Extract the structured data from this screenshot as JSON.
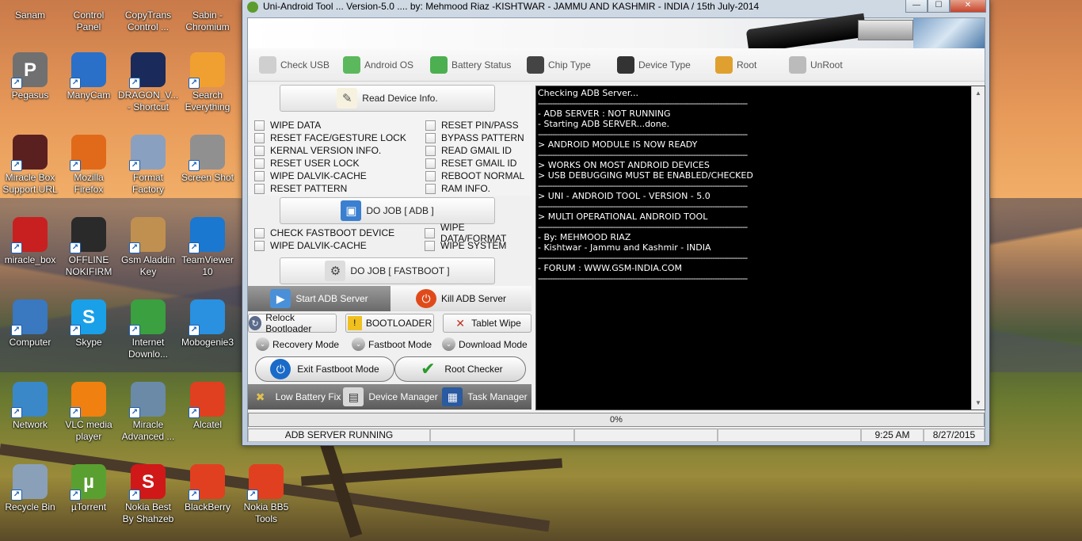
{
  "desktop": {
    "icons": [
      {
        "label": "Sanam",
        "col": 0,
        "row": 0,
        "color": "#b06030",
        "glyph": ""
      },
      {
        "label": "Control\nPanel",
        "col": 1,
        "row": 0,
        "color": "#3a7fc0",
        "glyph": ""
      },
      {
        "label": "CopyTrans\nControl ...",
        "col": 2,
        "row": 0,
        "color": "#4a90d0",
        "glyph": ""
      },
      {
        "label": "Sabin -\nChromium",
        "col": 3,
        "row": 0,
        "color": "#4a80c8",
        "glyph": ""
      },
      {
        "label": "Pegasus",
        "col": 0,
        "row": 1,
        "color": "#707070",
        "glyph": "P"
      },
      {
        "label": "ManyCam",
        "col": 1,
        "row": 1,
        "color": "#2a70c8",
        "glyph": ""
      },
      {
        "label": "DRAGON_V...\n- Shortcut",
        "col": 2,
        "row": 1,
        "color": "#1a2a5a",
        "glyph": ""
      },
      {
        "label": "Search\nEverything",
        "col": 3,
        "row": 1,
        "color": "#f0a030",
        "glyph": ""
      },
      {
        "label": "Miracle Box\nSupport.URL",
        "col": 0,
        "row": 2,
        "color": "#5a2020",
        "glyph": ""
      },
      {
        "label": "Mozilla\nFirefox",
        "col": 1,
        "row": 2,
        "color": "#e06a1a",
        "glyph": ""
      },
      {
        "label": "Format\nFactory",
        "col": 2,
        "row": 2,
        "color": "#8aa0c0",
        "glyph": ""
      },
      {
        "label": "Screen Shot",
        "col": 3,
        "row": 2,
        "color": "#909090",
        "glyph": ""
      },
      {
        "label": "miracle_box",
        "col": 0,
        "row": 3,
        "color": "#c82020",
        "glyph": ""
      },
      {
        "label": "OFFLINE\nNOKIFIRM",
        "col": 1,
        "row": 3,
        "color": "#2a2a2a",
        "glyph": ""
      },
      {
        "label": "Gsm Aladdin\nKey",
        "col": 2,
        "row": 3,
        "color": "#c09050",
        "glyph": ""
      },
      {
        "label": "TeamViewer\n10",
        "col": 3,
        "row": 3,
        "color": "#1a78d0",
        "glyph": ""
      },
      {
        "label": "Computer",
        "col": 0,
        "row": 4,
        "color": "#3a78c0",
        "glyph": ""
      },
      {
        "label": "Skype",
        "col": 1,
        "row": 4,
        "color": "#1aa0e8",
        "glyph": "S"
      },
      {
        "label": "Internet\nDownlo...",
        "col": 2,
        "row": 4,
        "color": "#3aa040",
        "glyph": ""
      },
      {
        "label": "Mobogenie3",
        "col": 3,
        "row": 4,
        "color": "#2a90e0",
        "glyph": ""
      },
      {
        "label": "Network",
        "col": 0,
        "row": 5,
        "color": "#3a88c8",
        "glyph": ""
      },
      {
        "label": "VLC media\nplayer",
        "col": 1,
        "row": 5,
        "color": "#f08010",
        "glyph": ""
      },
      {
        "label": "Miracle\nAdvanced ...",
        "col": 2,
        "row": 5,
        "color": "#6a8aa8",
        "glyph": ""
      },
      {
        "label": "Alcatel",
        "col": 3,
        "row": 5,
        "color": "#e04020",
        "glyph": ""
      },
      {
        "label": "Recycle Bin",
        "col": 0,
        "row": 6,
        "color": "#8aa0b8",
        "glyph": ""
      },
      {
        "label": "µTorrent",
        "col": 1,
        "row": 6,
        "color": "#5aa030",
        "glyph": "µ"
      },
      {
        "label": "Nokia Best\nBy Shahzeb",
        "col": 2,
        "row": 6,
        "color": "#d01818",
        "glyph": "S"
      },
      {
        "label": "BlackBerry",
        "col": 3,
        "row": 6,
        "color": "#e04020",
        "glyph": ""
      },
      {
        "label": "Nokia BB5\nTools",
        "col": 4,
        "row": 6,
        "color": "#e04020",
        "glyph": ""
      }
    ]
  },
  "window": {
    "title": "Uni-Android Tool ... Version-5.0 .... by: Mehmood Riaz -KISHTWAR - JAMMU AND KASHMIR - INDIA   / 15th July-2014",
    "minimize": "—",
    "maximize": "☐",
    "close": "✕"
  },
  "toolbar": {
    "items": [
      {
        "label": "Check USB",
        "icon": "usb-icon",
        "color": "#cfcfcf"
      },
      {
        "label": "Android OS",
        "icon": "android-icon",
        "color": "#5cb85c"
      },
      {
        "label": "Battery Status",
        "icon": "battery-icon",
        "color": "#4caf50"
      },
      {
        "label": "Chip Type",
        "icon": "chip-icon",
        "color": "#444444"
      },
      {
        "label": "Device Type",
        "icon": "device-icon",
        "color": "#333333"
      },
      {
        "label": "Root",
        "icon": "root-icon",
        "color": "#e0a030"
      },
      {
        "label": "UnRoot",
        "icon": "gear-icon",
        "color": "#bbbbbb"
      }
    ]
  },
  "adb": {
    "read_info": "Read Device Info.",
    "options_left": [
      "WIPE DATA",
      "RESET FACE/GESTURE LOCK",
      "KERNAL VERSION INFO.",
      "RESET USER LOCK",
      "WIPE DALVIK-CACHE",
      "RESET PATTERN"
    ],
    "options_right": [
      "RESET PIN/PASS",
      "BYPASS PATTERN",
      "READ GMAIL ID",
      "RESET GMAIL ID",
      "REBOOT NORMAL",
      "RAM INFO."
    ],
    "do_job": "DO JOB [ ADB ]"
  },
  "fastboot": {
    "options_left": [
      "CHECK FASTBOOT DEVICE",
      "WIPE DALVIK-CACHE"
    ],
    "options_right": [
      "WIPE DATA/FORMAT",
      "WIPE SYSTEM"
    ],
    "do_job": "DO JOB [ FASTBOOT ]"
  },
  "server": {
    "start": "Start ADB Server",
    "kill": "Kill ADB Server"
  },
  "actions": {
    "relock": "Relock Bootloader",
    "bootloader": "BOOTLOADER",
    "tablet_wipe": "Tablet Wipe",
    "recovery": "Recovery Mode",
    "fastboot_mode": "Fastboot Mode",
    "download": "Download Mode",
    "exit_fastboot": "Exit Fastboot Mode",
    "root_checker": "Root Checker",
    "low_battery": "Low Battery Fix",
    "device_manager": "Device Manager",
    "task_manager": "Task Manager"
  },
  "console": {
    "separator": "-----------------------------------------------------------------------------------------",
    "lines": [
      {
        "t": "Checking ADB Server...",
        "sep": true
      },
      {
        "t": "- ADB SERVER : NOT RUNNING"
      },
      {
        "t": "- Starting ADB SERVER...done.",
        "sep": true
      },
      {
        "t": "> ANDROID MODULE IS NOW READY",
        "sep": true
      },
      {
        "t": "> WORKS ON MOST ANDROID DEVICES"
      },
      {
        "t": "> USB DEBUGGING MUST BE ENABLED/CHECKED",
        "sep": true
      },
      {
        "t": "> UNI - ANDROID TOOL - VERSION - 5.0",
        "sep": true
      },
      {
        "t": "> MULTI OPERATIONAL ANDROID TOOL",
        "sep": true
      },
      {
        "t": "- By: MEHMOOD RIAZ"
      },
      {
        "t": "- Kishtwar - Jammu and Kashmir - INDIA",
        "sep": true
      },
      {
        "t": "- FORUM  :  WWW.GSM-INDIA.COM",
        "sep": true
      }
    ]
  },
  "progress": {
    "label": "0%",
    "value": 0
  },
  "status": {
    "state": "ADB SERVER RUNNING",
    "time": "9:25 AM",
    "date": "8/27/2015"
  }
}
